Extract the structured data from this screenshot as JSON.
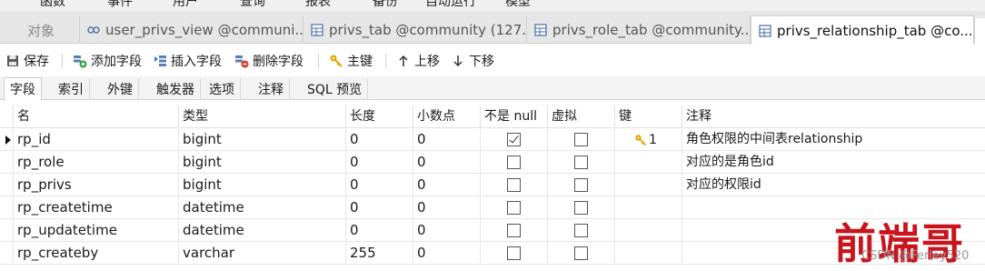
{
  "menu": {
    "items": [
      "函数",
      "事件",
      "用户",
      "查询",
      "报表",
      "备份",
      "自动运行",
      "模型"
    ]
  },
  "tabs": {
    "objects_label": "对象",
    "items": [
      {
        "label": "user_privs_view @communi...",
        "icon": "view-icon"
      },
      {
        "label": "privs_tab @community (127...",
        "icon": "table-icon"
      },
      {
        "label": "privs_role_tab @community...",
        "icon": "table-icon"
      },
      {
        "label": "privs_relationship_tab @co...",
        "icon": "table-icon"
      }
    ]
  },
  "toolbar": {
    "save": "保存",
    "add_field": "添加字段",
    "insert_field": "插入字段",
    "delete_field": "删除字段",
    "primary_key": "主键",
    "move_up": "上移",
    "move_down": "下移"
  },
  "subtabs": [
    "字段",
    "索引",
    "外键",
    "触发器",
    "选项",
    "注释",
    "SQL 预览"
  ],
  "columns": {
    "name": "名",
    "type": "类型",
    "length": "长度",
    "decimals": "小数点",
    "not_null": "不是 null",
    "virtual": "虚拟",
    "key": "键",
    "comment": "注释"
  },
  "rows": [
    {
      "name": "rp_id",
      "type": "bigint",
      "length": "0",
      "decimals": "0",
      "not_null": true,
      "virtual": false,
      "key": "1",
      "comment": "角色权限的中间表relationship"
    },
    {
      "name": "rp_role",
      "type": "bigint",
      "length": "0",
      "decimals": "0",
      "not_null": false,
      "virtual": false,
      "key": "",
      "comment": "对应的是角色id"
    },
    {
      "name": "rp_privs",
      "type": "bigint",
      "length": "0",
      "decimals": "0",
      "not_null": false,
      "virtual": false,
      "key": "",
      "comment": "对应的权限id"
    },
    {
      "name": "rp_createtime",
      "type": "datetime",
      "length": "0",
      "decimals": "0",
      "not_null": false,
      "virtual": false,
      "key": "",
      "comment": ""
    },
    {
      "name": "rp_updatetime",
      "type": "datetime",
      "length": "0",
      "decimals": "0",
      "not_null": false,
      "virtual": false,
      "key": "",
      "comment": ""
    },
    {
      "name": "rp_createby",
      "type": "varchar",
      "length": "255",
      "decimals": "0",
      "not_null": false,
      "virtual": false,
      "key": "",
      "comment": ""
    }
  ],
  "watermark": {
    "big": "前端哥",
    "small": "CSDN @Ferley520"
  },
  "colors": {
    "watermark": "#c8141c",
    "key_gold": "#e0a800"
  }
}
